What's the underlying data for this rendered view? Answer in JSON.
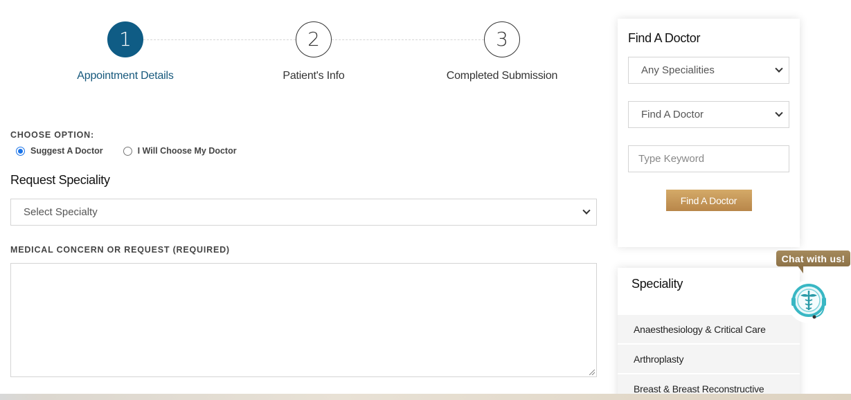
{
  "stepper": {
    "steps": [
      {
        "number": "1",
        "label": "Appointment Details",
        "active": true
      },
      {
        "number": "2",
        "label": "Patient's Info",
        "active": false
      },
      {
        "number": "3",
        "label": "Completed Submission",
        "active": false
      }
    ]
  },
  "form": {
    "choose_option_label": "CHOOSE OPTION:",
    "options": [
      {
        "label": "Suggest A Doctor",
        "checked": true
      },
      {
        "label": "I Will Choose My Doctor",
        "checked": false
      }
    ],
    "request_speciality_title": "Request Speciality",
    "specialty_select_value": "Select Specialty",
    "medical_concern_label": "MEDICAL CONCERN OR REQUEST (REQUIRED)"
  },
  "find_doctor": {
    "title": "Find A Doctor",
    "speciality_select_value": "Any Specialities",
    "doctor_select_value": "Find A Doctor",
    "keyword_placeholder": "Type Keyword",
    "button_label": "Find A Doctor"
  },
  "speciality_panel": {
    "title": "Speciality",
    "items": [
      "Anaesthesiology & Critical Care",
      "Arthroplasty",
      "Breast & Breast Reconstructive"
    ]
  },
  "chat": {
    "label": "Chat with us!"
  },
  "colors": {
    "primary": "#0f5c85",
    "accent_gold": "#c49a5a",
    "chat_gold": "#9a7f52"
  }
}
